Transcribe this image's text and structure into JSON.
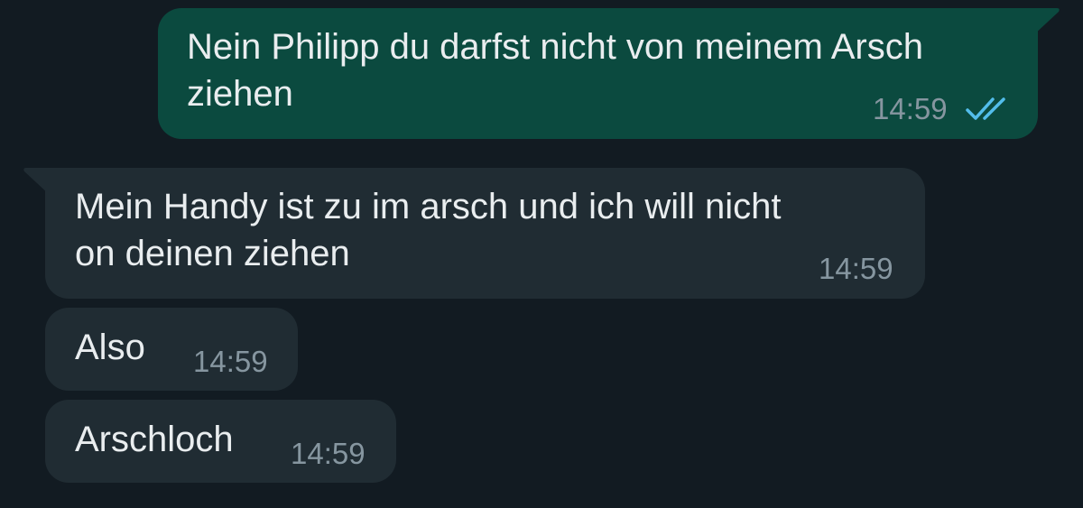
{
  "colors": {
    "background": "#121b22",
    "outgoing_bubble": "#0b4a3f",
    "incoming_bubble": "#202c33",
    "message_text": "#e9edef",
    "timestamp_text": "#8696a0",
    "read_ticks": "#53bdeb"
  },
  "messages": [
    {
      "direction": "outgoing",
      "line1": "Nein Philipp du darfst nicht von meinem Arsch",
      "line2": "ziehen",
      "time": "14:59",
      "status_icon": "double-check-read-icon"
    },
    {
      "direction": "incoming",
      "line1": "Mein Handy ist zu im arsch und ich will nicht",
      "line2": "on deinen ziehen",
      "time": "14:59"
    },
    {
      "direction": "incoming",
      "line1": "Also",
      "time": "14:59"
    },
    {
      "direction": "incoming",
      "line1": "Arschloch",
      "time": "14:59"
    }
  ]
}
